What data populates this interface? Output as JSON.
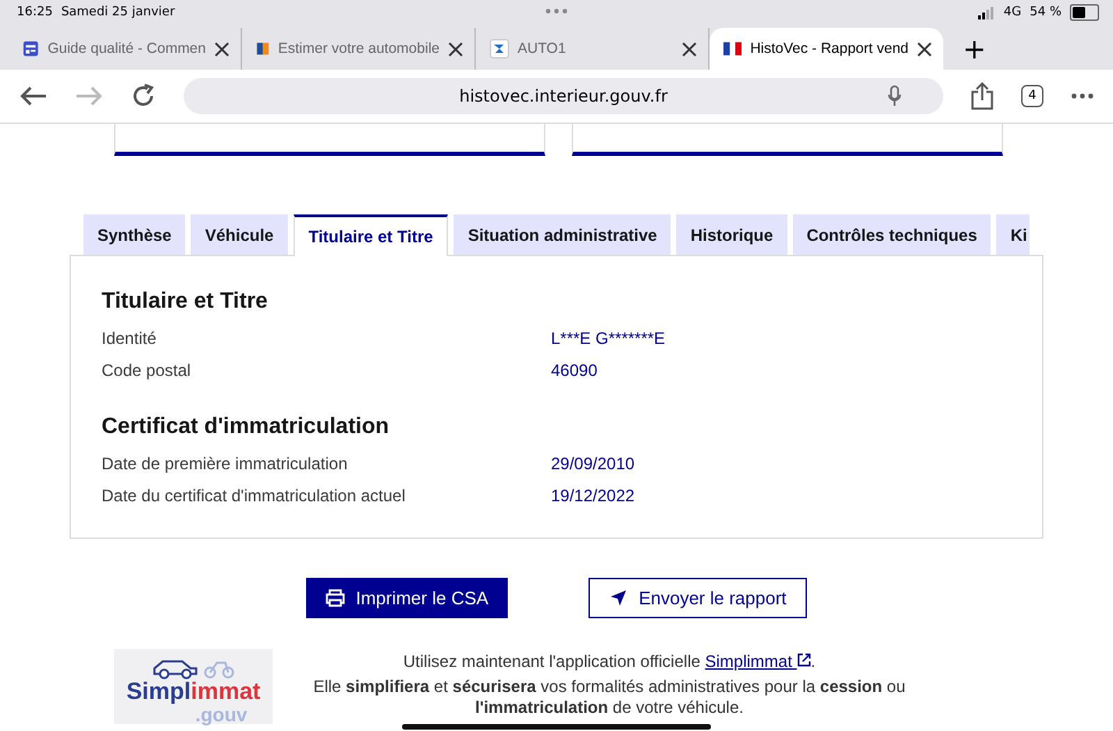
{
  "status_bar": {
    "time": "16:25",
    "date": "Samedi 25 janvier",
    "network": "4G",
    "battery": "54 %"
  },
  "browser_tabs": [
    {
      "title": "Guide qualité - Commen",
      "selected": false
    },
    {
      "title": "Estimer votre automobile",
      "selected": false
    },
    {
      "title": "AUTO1",
      "selected": false
    },
    {
      "title": "HistoVec - Rapport vend",
      "selected": true
    }
  ],
  "new_tab": "+",
  "address_bar": {
    "url": "histovec.interieur.gouv.fr",
    "tab_count": "4",
    "forward_disabled": true
  },
  "page_tabs": [
    {
      "label": "Synthèse",
      "selected": false
    },
    {
      "label": "Véhicule",
      "selected": false
    },
    {
      "label": "Titulaire et Titre",
      "selected": true
    },
    {
      "label": "Situation administrative",
      "selected": false
    },
    {
      "label": "Historique",
      "selected": false
    },
    {
      "label": "Contrôles techniques",
      "selected": false
    },
    {
      "label": "Ki",
      "selected": false
    }
  ],
  "sections": [
    {
      "title": "Titulaire et Titre",
      "rows": [
        {
          "label": "Identité",
          "value": "L***E G*******E"
        },
        {
          "label": "Code postal",
          "value": "46090"
        }
      ]
    },
    {
      "title": "Certificat d'immatriculation",
      "rows": [
        {
          "label": "Date de première immatriculation",
          "value": "29/09/2010"
        },
        {
          "label": "Date du certificat d'immatriculation actuel",
          "value": "19/12/2022"
        }
      ]
    }
  ],
  "actions": [
    {
      "label": "Imprimer le CSA",
      "kind": "primary"
    },
    {
      "label": "Envoyer le rapport",
      "kind": "secondary"
    }
  ],
  "promo": {
    "logo": {
      "part_1": "Simpl",
      "part_2": "immat",
      "suffix": ".gouv"
    },
    "line_1": "Utilisez maintenant l'application officielle",
    "link": "Simplimmat",
    "line_1_end": ".",
    "line_2": "Elle **simplifiera** et **sécurisera** vos formalités administratives pour la **cession** ou **l'immatriculation** de votre véhicule."
  }
}
